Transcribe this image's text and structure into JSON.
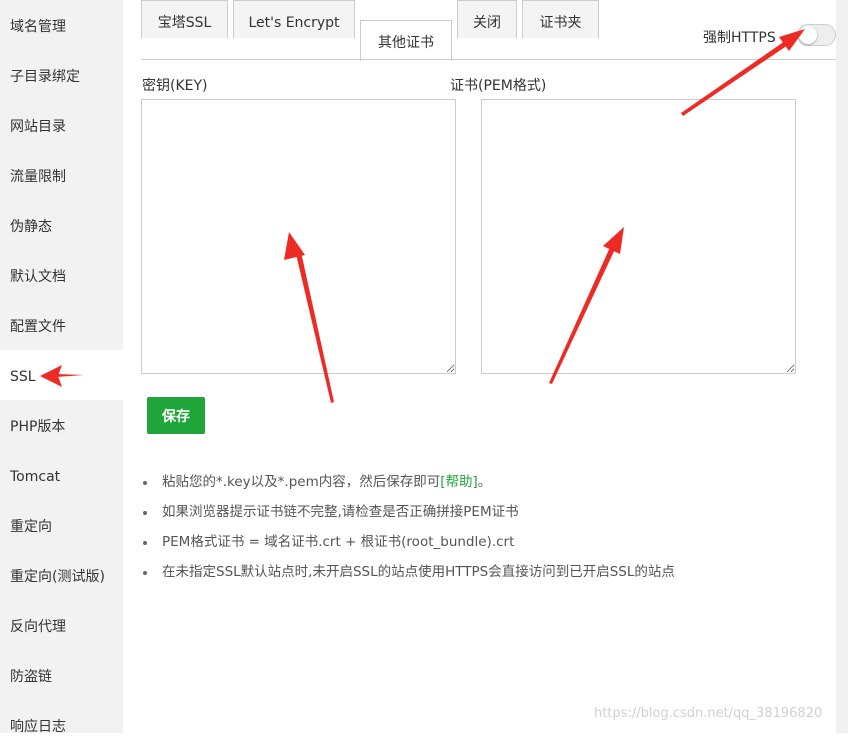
{
  "sidebar": {
    "items": [
      {
        "label": "域名管理"
      },
      {
        "label": "子目录绑定"
      },
      {
        "label": "网站目录"
      },
      {
        "label": "流量限制"
      },
      {
        "label": "伪静态"
      },
      {
        "label": "默认文档"
      },
      {
        "label": "配置文件"
      },
      {
        "label": "SSL"
      },
      {
        "label": "PHP版本"
      },
      {
        "label": "Tomcat"
      },
      {
        "label": "重定向"
      },
      {
        "label": "重定向(测试版)"
      },
      {
        "label": "反向代理"
      },
      {
        "label": "防盗链"
      },
      {
        "label": "响应日志"
      }
    ],
    "active_index": 7
  },
  "tabs": [
    {
      "label": "宝塔SSL"
    },
    {
      "label": "Let's Encrypt"
    },
    {
      "label": "其他证书"
    },
    {
      "label": "关闭"
    },
    {
      "label": "证书夹"
    }
  ],
  "active_tab_index": 2,
  "force_https": {
    "label": "强制HTTPS",
    "enabled": false
  },
  "key_field": {
    "label": "密钥(KEY)",
    "value": ""
  },
  "cert_field": {
    "label": "证书(PEM格式)",
    "value": ""
  },
  "save_button": {
    "label": "保存"
  },
  "notes": {
    "note1_prefix": "粘贴您的*.key以及*.pem内容，然后保存即可",
    "note1_link": "[帮助]",
    "note1_suffix": "。",
    "note2": "如果浏览器提示证书链不完整,请检查是否正确拼接PEM证书",
    "note3": "PEM格式证书 = 域名证书.crt + 根证书(root_bundle).crt",
    "note4": "在未指定SSL默认站点时,未开启SSL的站点使用HTTPS会直接访问到已开启SSL的站点"
  },
  "watermark": "https://blog.csdn.net/qq_38196820",
  "colors": {
    "accent": "#20a53a",
    "annotation_arrow": "#ee2a24",
    "sidebar_bg": "#f2f2f2"
  }
}
